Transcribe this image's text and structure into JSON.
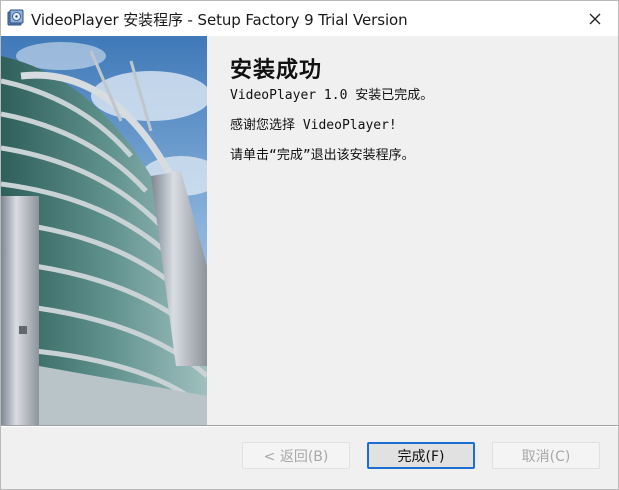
{
  "window": {
    "title": "VideoPlayer 安装程序 - Setup Factory 9 Trial Version",
    "app_icon": "installer-disc-icon",
    "close_icon": "close-icon"
  },
  "content": {
    "heading": "安装成功",
    "line1": "VideoPlayer 1.0 安装已完成。",
    "line2": "感谢您选择 VideoPlayer!",
    "line3": "请单击“完成”退出该安装程序。"
  },
  "buttons": {
    "back": "< 返回(B)",
    "finish": "完成(F)",
    "cancel": "取消(C)"
  },
  "colors": {
    "focus_border": "#1a6fd1",
    "panel": "#f0f0f0"
  }
}
